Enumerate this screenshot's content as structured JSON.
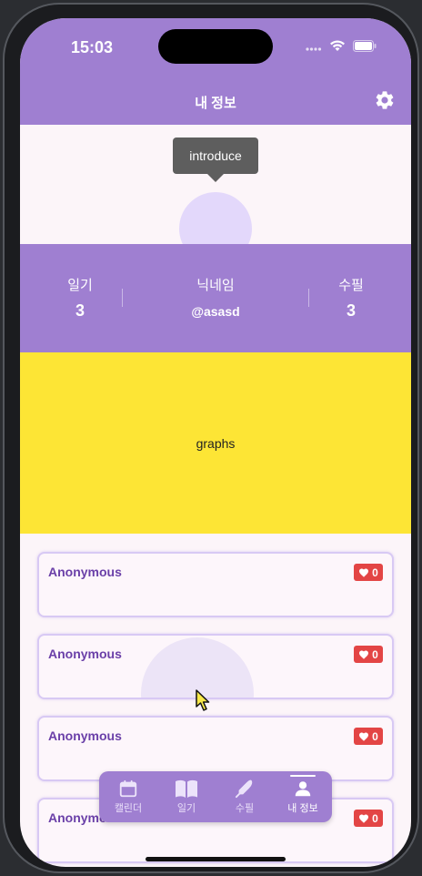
{
  "status_bar": {
    "time": "15:03"
  },
  "header": {
    "title": "내 정보"
  },
  "profile": {
    "tooltip": "introduce"
  },
  "stats": {
    "diary_label": "일기",
    "diary_count": "3",
    "nickname_label": "닉네임",
    "nickname": "@asasd",
    "essay_label": "수필",
    "essay_count": "3"
  },
  "graphs": {
    "label": "graphs"
  },
  "feed": {
    "cards": [
      {
        "author": "Anonymous",
        "likes": "0"
      },
      {
        "author": "Anonymous",
        "likes": "0"
      },
      {
        "author": "Anonymous",
        "likes": "0"
      },
      {
        "author": "Anonymous",
        "likes": "0"
      }
    ]
  },
  "nav": {
    "items": [
      {
        "label": "캘린더",
        "icon": "calendar-icon"
      },
      {
        "label": "일기",
        "icon": "book-icon"
      },
      {
        "label": "수필",
        "icon": "pen-icon"
      },
      {
        "label": "내 정보",
        "icon": "person-icon"
      }
    ],
    "active": "내 정보"
  },
  "colors": {
    "primary": "#9f7fd1",
    "graphs_bg": "#fde535",
    "like_badge": "#e34545",
    "author_text": "#6a3fa8"
  }
}
